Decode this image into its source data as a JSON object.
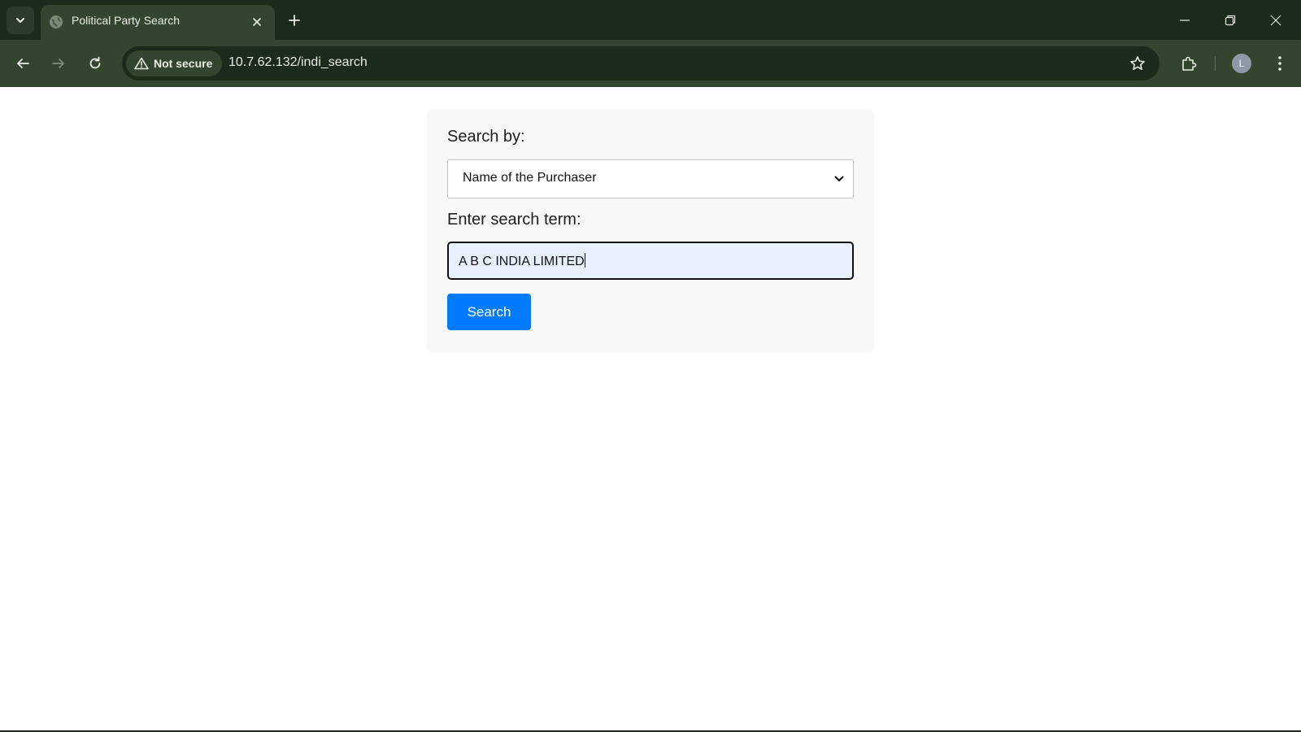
{
  "browser": {
    "tab": {
      "title": "Political Party Search",
      "favicon": "globe-icon"
    },
    "omnibox": {
      "security_label": "Not secure",
      "url": "10.7.62.132/indi_search"
    },
    "profile_initial": "L",
    "colors": {
      "frame": "#1c2a1c",
      "toolbar": "#34452f"
    }
  },
  "form": {
    "search_by_label": "Search by:",
    "search_by_selected": "Name of the Purchaser",
    "search_term_label": "Enter search term:",
    "search_term_value": "A B C INDIA LIMITED",
    "submit_label": "Search",
    "colors": {
      "button": "#007bff",
      "input_bg": "#e8f0fe",
      "card_bg": "#f8f8f8"
    }
  }
}
